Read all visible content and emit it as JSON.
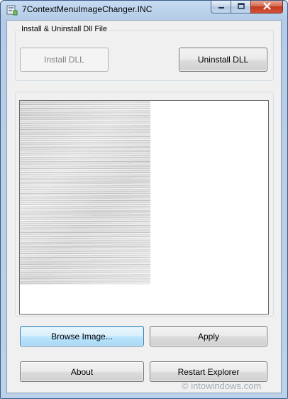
{
  "window": {
    "title": "7ContextMenuImageChanger.INC",
    "icon": "app-icon"
  },
  "caption_buttons": {
    "minimize": "minimize-icon",
    "maximize": "maximize-icon",
    "close": "close-icon"
  },
  "install_group": {
    "label": "Install & Uninstall Dll File",
    "install_label": "Install DLL",
    "install_enabled": false,
    "uninstall_label": "Uninstall DLL"
  },
  "preview": {
    "image": "brushed-metal texture"
  },
  "actions": {
    "browse_label": "Browse Image...",
    "apply_label": "Apply",
    "about_label": "About",
    "restart_label": "Restart Explorer"
  },
  "watermark": "© intowindows.com",
  "colors": {
    "frame": "#b9cfe8",
    "client": "#f0f0f0",
    "close": "#c3391c",
    "focus": "#3c7fb1"
  }
}
